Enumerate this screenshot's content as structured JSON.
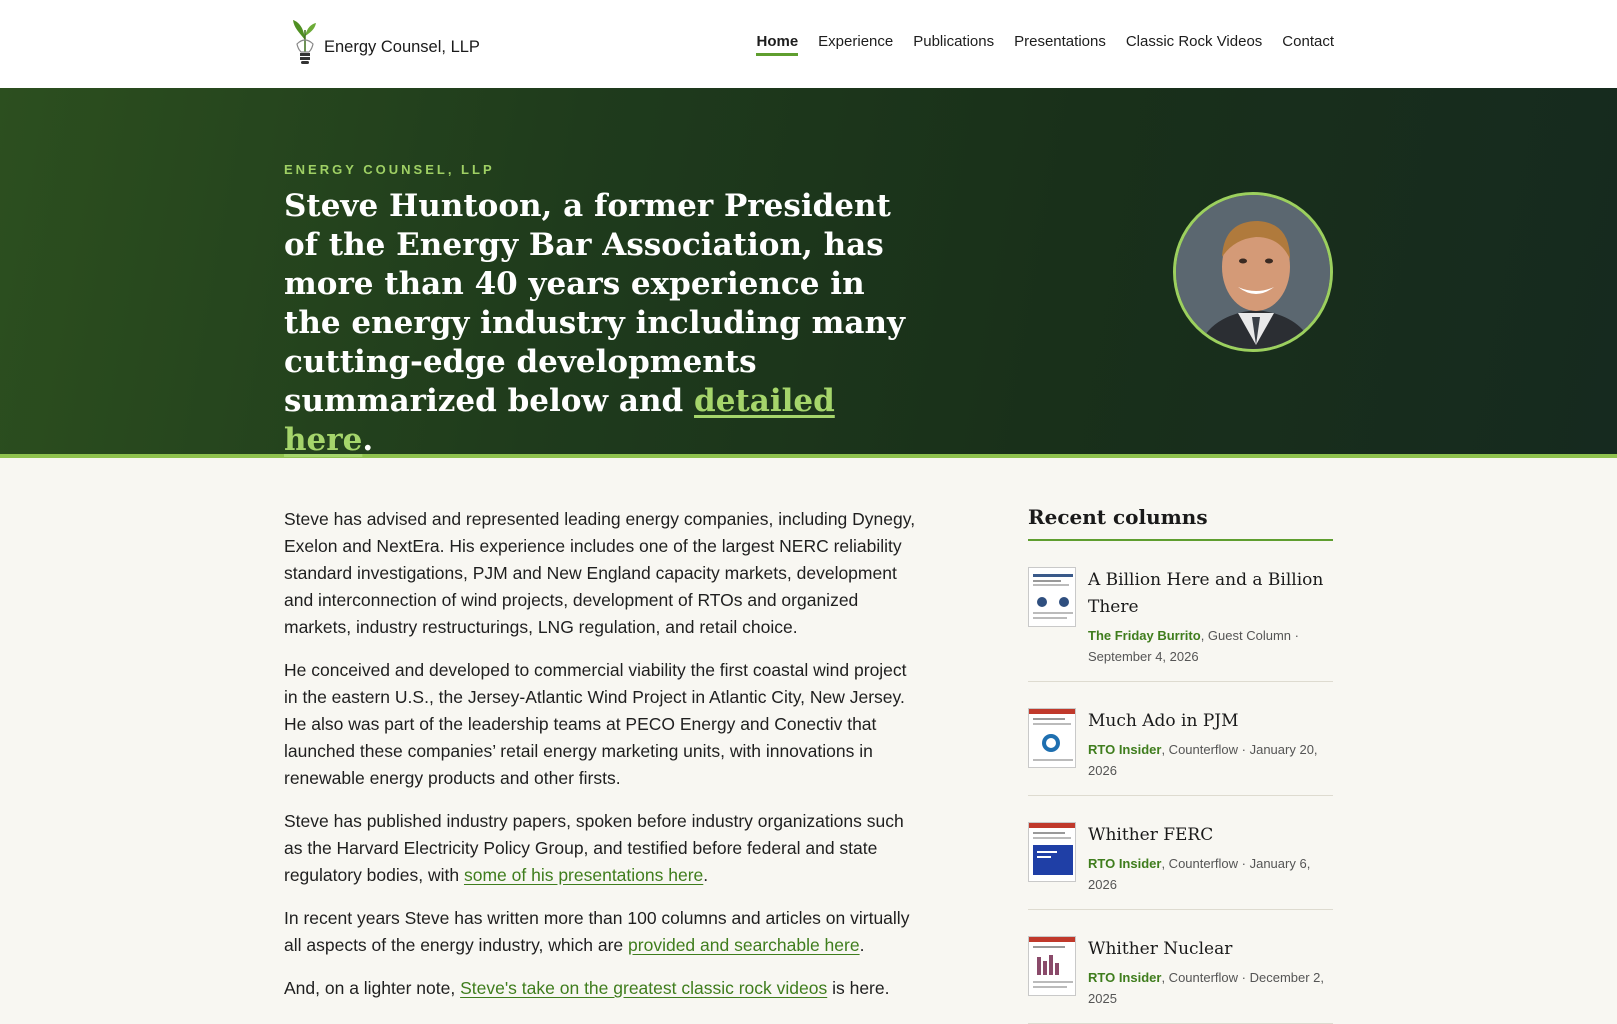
{
  "site": {
    "name": "Energy Counsel, LLP"
  },
  "nav": [
    {
      "label": "Home",
      "active": true
    },
    {
      "label": "Experience"
    },
    {
      "label": "Publications"
    },
    {
      "label": "Presentations"
    },
    {
      "label": "Classic Rock Videos"
    },
    {
      "label": "Contact"
    }
  ],
  "hero": {
    "eyebrow": "ENERGY COUNSEL, LLP",
    "headline_text": "Steve Huntoon, a former President of the Energy Bar Association, has more than 40 years experience in the energy industry including many cutting-edge developments summarized below and ",
    "headline_link": "detailed here",
    "headline_end": "."
  },
  "body": {
    "p1": "Steve has advised and represented leading energy companies, including Dynegy, Exelon and NextEra. His experience includes one of the largest NERC reliability standard investigations, PJM and New England capacity markets, development and interconnection of wind projects, development of RTOs and organized markets, industry restructurings, LNG regulation, and retail choice.",
    "p2": "He conceived and developed to commercial viability the first coastal wind project in the eastern U.S., the Jersey-Atlantic Wind Project in Atlantic City, New Jersey. He also was part of the leadership teams at PECO Energy and Conectiv that launched these companies’ retail energy marketing units, with innovations in renewable energy products and other firsts.",
    "p3_text": "Steve has published industry papers, spoken before industry organizations such as the Harvard Electricity Policy Group, and testified before federal and state regulatory bodies, with ",
    "p3_link": "some of his presentations here",
    "p3_end": ".",
    "p4_text": "In recent years Steve has written more than 100 columns and articles on virtually all aspects of the energy industry, which are ",
    "p4_link": "provided and searchable here",
    "p4_end": ".",
    "p5_text": "And, on a lighter note, ",
    "p5_link": "Steve's take on the greatest classic rock videos",
    "p5_end": " is here."
  },
  "sidebar": {
    "title": "Recent columns",
    "columns": [
      {
        "title": "A Billion Here and a Billion There",
        "publication": "The Friday Burrito",
        "rest": ", Guest Column · September 4, 2026"
      },
      {
        "title": "Much Ado in PJM",
        "publication": "RTO Insider",
        "rest": ", Counterflow · January 20, 2026"
      },
      {
        "title": "Whither FERC",
        "publication": "RTO Insider",
        "rest": ", Counterflow · January 6, 2026"
      },
      {
        "title": "Whither Nuclear",
        "publication": "RTO Insider",
        "rest": ", Counterflow · December 2, 2025"
      }
    ]
  }
}
